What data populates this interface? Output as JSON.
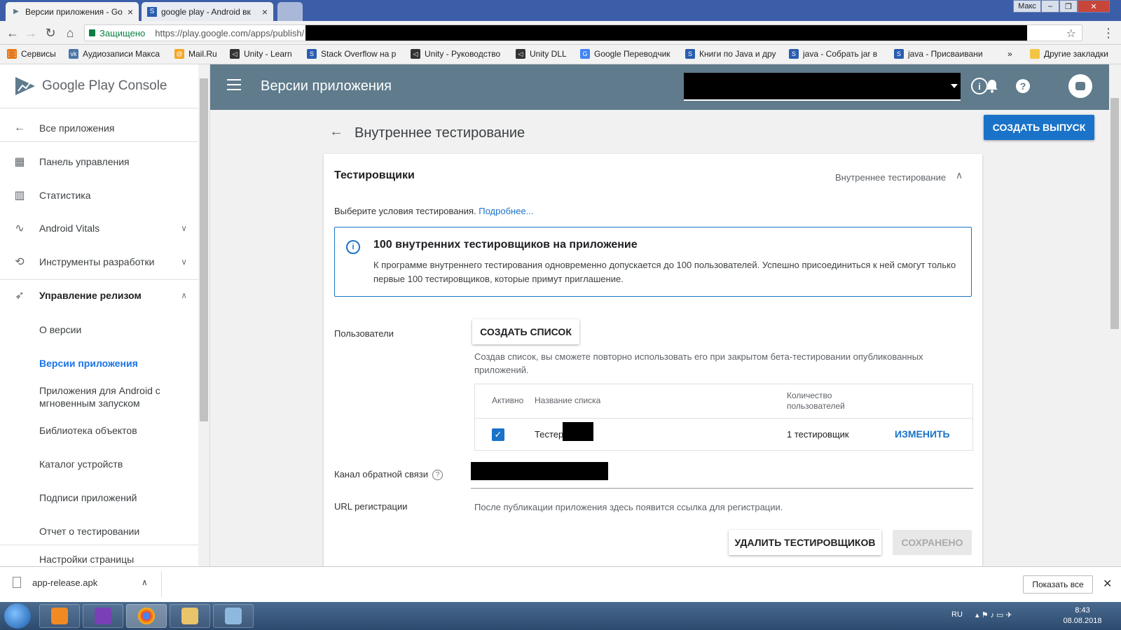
{
  "browser": {
    "tabs": [
      {
        "title": "Версии приложения - Go",
        "active": true
      },
      {
        "title": "google play - Android вк",
        "active": false
      }
    ],
    "profile": "Макс",
    "security_label": "Защищено",
    "url": "https://play.google.com/apps/publish/",
    "bookmarks": [
      {
        "label": "Сервисы",
        "icon": "apps-grid-icon"
      },
      {
        "label": "Аудиозаписи Макса",
        "icon": "vk-icon"
      },
      {
        "label": "Mail.Ru",
        "icon": "mailru-icon"
      },
      {
        "label": "Unity - Learn",
        "icon": "unity-icon"
      },
      {
        "label": "Stack Overflow на р",
        "icon": "page-icon"
      },
      {
        "label": "Unity - Руководство",
        "icon": "unity-icon"
      },
      {
        "label": "Unity DLL",
        "icon": "unity-icon"
      },
      {
        "label": "Google Переводчик",
        "icon": "translate-icon"
      },
      {
        "label": "Книги по Java и дру",
        "icon": "page-icon"
      },
      {
        "label": "java - Собрать jar в",
        "icon": "page-icon"
      },
      {
        "label": "java - Присваивани",
        "icon": "page-icon"
      }
    ],
    "bookmarks_overflow": "»",
    "other_bookmarks": "Другие закладки"
  },
  "sidebar": {
    "brand": "Google Play Console",
    "items": [
      {
        "label": "Все приложения",
        "icon": "arrow-left-icon"
      },
      {
        "label": "Панель управления",
        "icon": "dashboard-icon"
      },
      {
        "label": "Статистика",
        "icon": "bar-chart-icon"
      },
      {
        "label": "Android Vitals",
        "icon": "pulse-icon",
        "expandable": true
      },
      {
        "label": "Инструменты разработки",
        "icon": "tools-icon",
        "expandable": true
      },
      {
        "label": "Управление релизом",
        "icon": "rocket-icon",
        "expanded": true
      },
      {
        "label": "О версии"
      },
      {
        "label": "Версии приложения",
        "active": true
      },
      {
        "label": "Приложения для Android с мгновенным запуском"
      },
      {
        "label": "Библиотека объектов"
      },
      {
        "label": "Каталог устройств"
      },
      {
        "label": "Подписи приложений"
      },
      {
        "label": "Отчет о тестировании"
      },
      {
        "label": "Настройки страницы"
      }
    ]
  },
  "appbar": {
    "title": "Версии приложения"
  },
  "main": {
    "page_title": "Внутреннее тестирование",
    "create_release": "СОЗДАТЬ ВЫПУСК",
    "card": {
      "title": "Тестировщики",
      "track": "Внутреннее тестирование",
      "hint": "Выберите условия тестирования.",
      "hint_link": "Подробнее...",
      "info_title": "100 внутренних тестировщиков на приложение",
      "info_text": "К программе внутреннего тестирования одновременно допускается до 100 пользователей. Успешно присоединиться к ней смогут только первые 100 тестировщиков, которые примут приглашение.",
      "users_label": "Пользователи",
      "create_list": "СОЗДАТЬ СПИСОК",
      "create_list_desc": "Создав список, вы сможете повторно использовать его при закрытом бета-тестировании опубликованных приложений.",
      "table": {
        "headers": [
          "Активно",
          "Название списка",
          "Количество пользователей"
        ],
        "rows": [
          {
            "active": true,
            "name": "Тестер",
            "count": "1 тестировщик",
            "action": "ИЗМЕНИТЬ"
          }
        ]
      },
      "feedback_label": "Канал обратной связи",
      "url_label": "URL регистрации",
      "url_text": "После публикации приложения здесь появится ссылка для регистрации.",
      "remove_testers": "УДАЛИТЬ ТЕСТИРОВЩИКОВ",
      "saved": "СОХРАНЕНО"
    }
  },
  "downloads": {
    "file": "app-release.apk",
    "show_all": "Показать все"
  },
  "taskbar": {
    "lang": "RU",
    "time": "8:43",
    "date": "08.08.2018"
  },
  "colors": {
    "appbar": "#5f7b8c",
    "primary": "#1a73c8",
    "active_nav": "#1a73e8"
  }
}
